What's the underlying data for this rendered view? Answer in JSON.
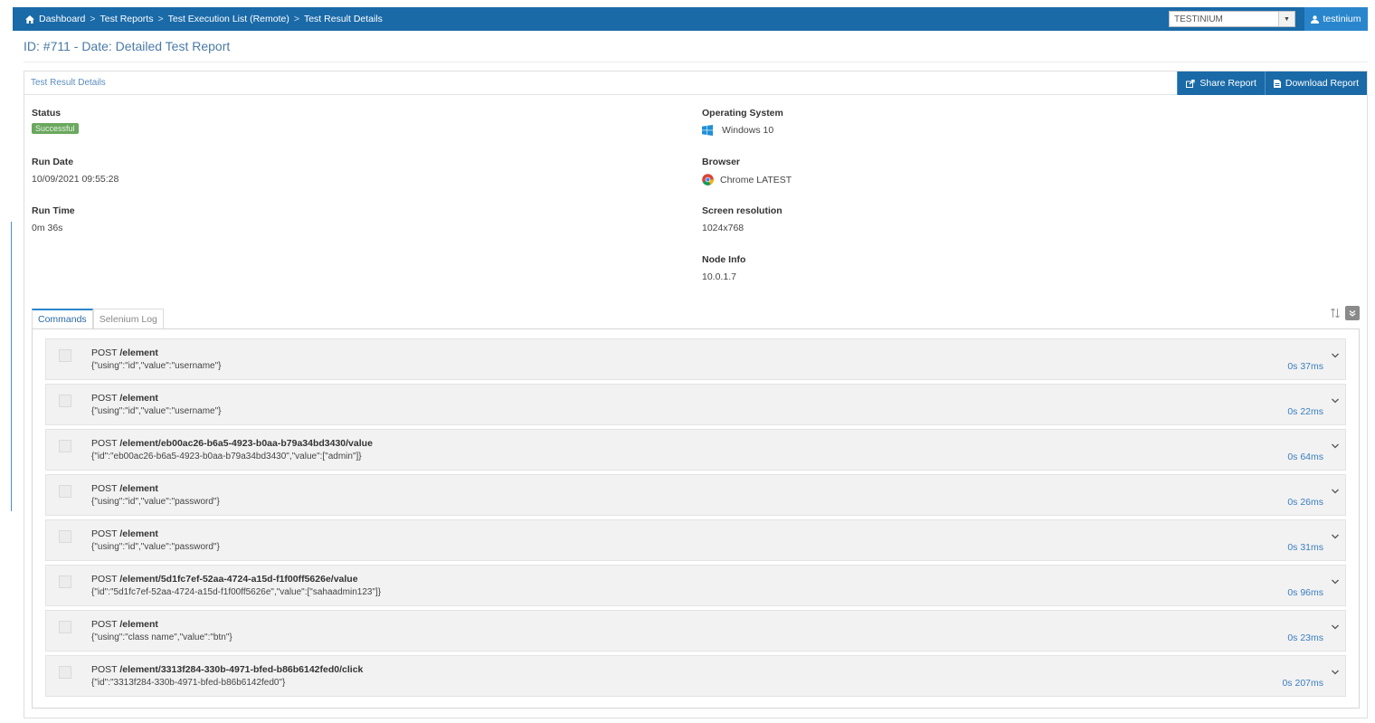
{
  "breadcrumb": {
    "items": [
      "Dashboard",
      "Test Reports",
      "Test Execution List (Remote)",
      "Test Result Details"
    ],
    "separators": [
      ">",
      ">",
      ">"
    ]
  },
  "tenant_select": {
    "value": "TESTINIUM"
  },
  "user": {
    "label": "testinium"
  },
  "page": {
    "title": "ID: #711 - Date: Detailed Test Report"
  },
  "panel": {
    "title": "Test Result Details",
    "share_label": "Share Report",
    "download_label": "Download Report"
  },
  "details": {
    "status_label": "Status",
    "status_value": "Successful",
    "run_date_label": "Run Date",
    "run_date_value": "10/09/2021 09:55:28",
    "run_time_label": "Run Time",
    "run_time_value": "0m 36s",
    "os_label": "Operating System",
    "os_value": "Windows 10",
    "browser_label": "Browser",
    "browser_value": "Chrome LATEST",
    "resolution_label": "Screen resolution",
    "resolution_value": "1024x768",
    "node_label": "Node Info",
    "node_value": "10.0.1.7"
  },
  "tabs": [
    {
      "label": "Commands",
      "active": true
    },
    {
      "label": "Selenium Log",
      "active": false
    }
  ],
  "commands": [
    {
      "method": "POST",
      "path": "/element",
      "body": "{\"using\":\"id\",\"value\":\"username\"}",
      "duration": "0s 37ms"
    },
    {
      "method": "POST",
      "path": "/element",
      "body": "{\"using\":\"id\",\"value\":\"username\"}",
      "duration": "0s 22ms"
    },
    {
      "method": "POST",
      "path": "/element/eb00ac26-b6a5-4923-b0aa-b79a34bd3430/value",
      "body": "{\"id\":\"eb00ac26-b6a5-4923-b0aa-b79a34bd3430\",\"value\":[\"admin\"]}",
      "duration": "0s 64ms"
    },
    {
      "method": "POST",
      "path": "/element",
      "body": "{\"using\":\"id\",\"value\":\"password\"}",
      "duration": "0s 26ms"
    },
    {
      "method": "POST",
      "path": "/element",
      "body": "{\"using\":\"id\",\"value\":\"password\"}",
      "duration": "0s 31ms"
    },
    {
      "method": "POST",
      "path": "/element/5d1fc7ef-52aa-4724-a15d-f1f00ff5626e/value",
      "body": "{\"id\":\"5d1fc7ef-52aa-4724-a15d-f1f00ff5626e\",\"value\":[\"sahaadmin123\"]}",
      "duration": "0s 96ms"
    },
    {
      "method": "POST",
      "path": "/element",
      "body": "{\"using\":\"class name\",\"value\":\"btn\"}",
      "duration": "0s 23ms"
    },
    {
      "method": "POST",
      "path": "/element/3313f284-330b-4971-bfed-b86b6142fed0/click",
      "body": "{\"id\":\"3313f284-330b-4971-bfed-b86b6142fed0\"}",
      "duration": "0s 207ms"
    }
  ],
  "colors": {
    "primary": "#1a6aa8",
    "success": "#6aa85e",
    "link": "#3a7ec0"
  },
  "icons": [
    "home-icon",
    "chevron-down-icon",
    "user-icon",
    "share-icon",
    "download-icon",
    "windows-icon",
    "chrome-icon",
    "sort-icon",
    "expand-icon"
  ]
}
